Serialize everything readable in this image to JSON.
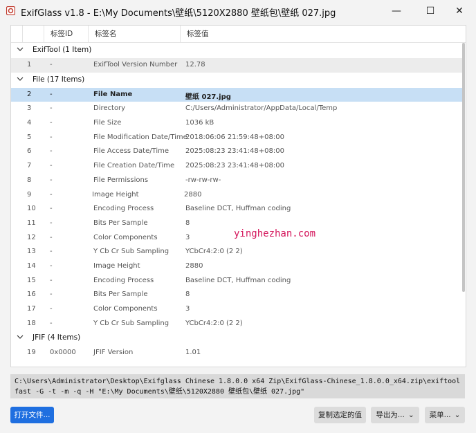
{
  "window": {
    "title": "ExifGlass v1.8 - E:\\My Documents\\壁纸\\5120X2880 壁纸包\\壁纸 027.jpg",
    "controls": {
      "minimize": "—",
      "maximize": "☐",
      "close": "✕"
    }
  },
  "columns": {
    "tag_id": "标签ID",
    "tag_name": "标签名",
    "tag_value": "标签值"
  },
  "groups": [
    {
      "title": "ExifTool (1 Item)",
      "rows": [
        {
          "idx": "1",
          "id": "-",
          "name": "ExifTool Version Number",
          "value": "12.78"
        }
      ]
    },
    {
      "title": "File (17 Items)",
      "rows": [
        {
          "idx": "2",
          "id": "-",
          "name": "File Name",
          "value": "壁纸 027.jpg"
        },
        {
          "idx": "3",
          "id": "-",
          "name": "Directory",
          "value": "C:/Users/Administrator/AppData/Local/Temp"
        },
        {
          "idx": "4",
          "id": "-",
          "name": "File Size",
          "value": "1036 kB"
        },
        {
          "idx": "5",
          "id": "-",
          "name": "File Modification Date/Time",
          "value": "2018:06:06 21:59:48+08:00"
        },
        {
          "idx": "6",
          "id": "-",
          "name": "File Access Date/Time",
          "value": "2025:08:23 23:41:48+08:00"
        },
        {
          "idx": "7",
          "id": "-",
          "name": "File Creation Date/Time",
          "value": "2025:08:23 23:41:48+08:00"
        },
        {
          "idx": "8",
          "id": "-",
          "name": "File Permissions",
          "value": "-rw-rw-rw-"
        },
        {
          "idx": "9",
          "id": "-",
          "name": "Image Height",
          "value": "2880"
        },
        {
          "idx": "10",
          "id": "-",
          "name": "Encoding Process",
          "value": "Baseline DCT, Huffman coding"
        },
        {
          "idx": "11",
          "id": "-",
          "name": "Bits Per Sample",
          "value": "8"
        },
        {
          "idx": "12",
          "id": "-",
          "name": "Color Components",
          "value": "3"
        },
        {
          "idx": "13",
          "id": "-",
          "name": "Y Cb Cr Sub Sampling",
          "value": "YCbCr4:2:0 (2 2)"
        },
        {
          "idx": "14",
          "id": "-",
          "name": "Image Height",
          "value": "2880"
        },
        {
          "idx": "15",
          "id": "-",
          "name": "Encoding Process",
          "value": "Baseline DCT, Huffman coding"
        },
        {
          "idx": "16",
          "id": "-",
          "name": "Bits Per Sample",
          "value": "8"
        },
        {
          "idx": "17",
          "id": "-",
          "name": "Color Components",
          "value": "3"
        },
        {
          "idx": "18",
          "id": "-",
          "name": "Y Cb Cr Sub Sampling",
          "value": "YCbCr4:2:0 (2 2)"
        }
      ]
    },
    {
      "title": "JFIF (4 Items)",
      "rows": [
        {
          "idx": "19",
          "id": "0x0000",
          "name": "JFIF Version",
          "value": "1.01"
        }
      ]
    }
  ],
  "selected_row": "2",
  "watermark": "yinghezhan.com",
  "command": {
    "line1": "C:\\Users\\Administrator\\Desktop\\Exifglass Chinese 1.8.0.0 x64 Zip\\ExifGlass-Chinese_1.8.0.0_x64.zip\\exiftool.exe -",
    "line2": "fast -G -t -m -q -H  \"E:\\My Documents\\壁纸\\5120X2880 壁纸包\\壁纸 027.jpg\""
  },
  "buttons": {
    "open": "打开文件...",
    "copy": "复制选定的值",
    "export": "导出为...",
    "menu": "菜单..."
  },
  "colors": {
    "accent": "#1f6fe0",
    "selection": "#c7dff5",
    "watermark": "#d4145a"
  }
}
